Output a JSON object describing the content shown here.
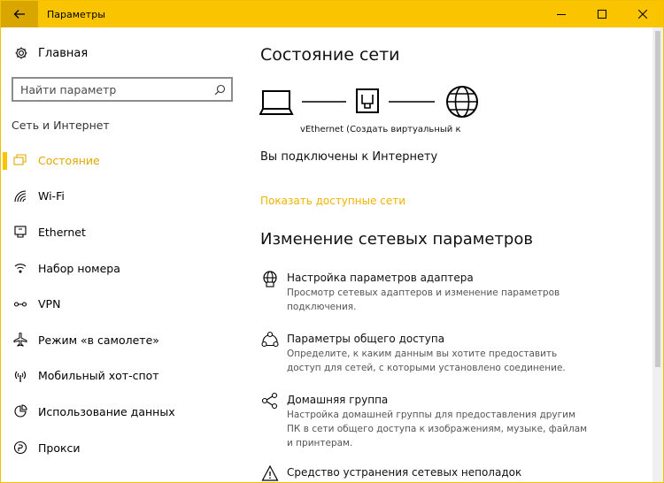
{
  "window": {
    "title": "Параметры",
    "accent": "#fbc400"
  },
  "titlebar": {
    "back_icon": "arrow-left-icon",
    "controls": [
      "minimize-icon",
      "maximize-icon",
      "close-icon"
    ]
  },
  "sidebar": {
    "home_label": "Главная",
    "search_placeholder": "Найти параметр",
    "section_label": "Сеть и Интернет",
    "items": [
      {
        "label": "Состояние",
        "icon": "network-status-icon",
        "active": true
      },
      {
        "label": "Wi-Fi",
        "icon": "wifi-icon",
        "active": false
      },
      {
        "label": "Ethernet",
        "icon": "ethernet-icon",
        "active": false
      },
      {
        "label": "Набор номера",
        "icon": "dialup-icon",
        "active": false
      },
      {
        "label": "VPN",
        "icon": "vpn-icon",
        "active": false
      },
      {
        "label": "Режим «в самолете»",
        "icon": "airplane-icon",
        "active": false
      },
      {
        "label": "Мобильный хот-спот",
        "icon": "hotspot-icon",
        "active": false
      },
      {
        "label": "Использование данных",
        "icon": "data-usage-icon",
        "active": false
      },
      {
        "label": "Прокси",
        "icon": "proxy-icon",
        "active": false
      }
    ]
  },
  "main": {
    "title": "Состояние сети",
    "adapter_label": "vEthernet (Создать виртуальный к",
    "status_text": "Вы подключены к Интернету",
    "show_networks_link": "Показать доступные сети",
    "change_title": "Изменение сетевых параметров",
    "settings": [
      {
        "title": "Настройка параметров адаптера",
        "desc": "Просмотр сетевых адаптеров и изменение параметров подключения.",
        "icon": "adapter-icon"
      },
      {
        "title": "Параметры общего доступа",
        "desc": "Определите, к каким данным вы хотите предоставить доступ для сетей, с которыми установлено соединение.",
        "icon": "sharing-icon"
      },
      {
        "title": "Домашняя группа",
        "desc": "Настройка домашней группы для предоставления другим ПК в сети общего доступа к изображениям, музыке, файлам и принтерам.",
        "icon": "homegroup-icon"
      },
      {
        "title": "Средство устранения сетевых неполадок",
        "desc": "",
        "icon": "warning-icon"
      }
    ]
  }
}
